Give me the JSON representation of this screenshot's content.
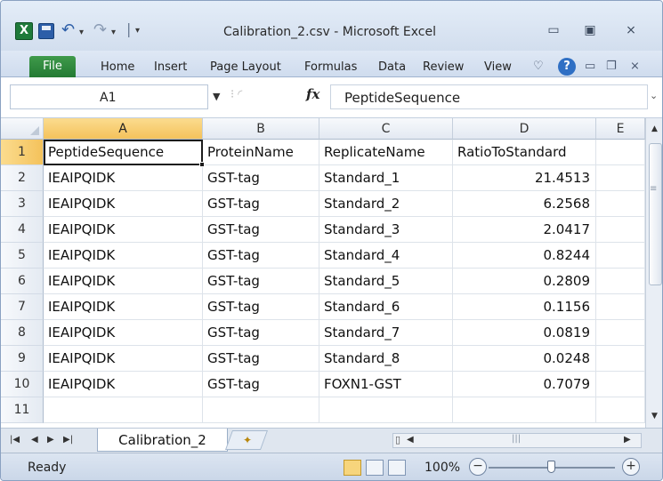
{
  "window": {
    "title": "Calibration_2.csv - Microsoft Excel",
    "controls": {
      "minimize": "▭",
      "restore": "▣",
      "close": "⨯"
    }
  },
  "quick_access": {
    "icons": [
      "excel-icon",
      "save-icon",
      "undo-icon",
      "redo-icon",
      "customize-icon"
    ],
    "separator": "|"
  },
  "ribbon": {
    "file_label": "File",
    "tabs": [
      "Home",
      "Insert",
      "Page Layout",
      "Formulas",
      "Data",
      "Review",
      "View"
    ],
    "help": "?"
  },
  "formula_bar": {
    "name_box": "A1",
    "fx_label": "fx",
    "content": "PeptideSequence"
  },
  "grid": {
    "columns": [
      "A",
      "B",
      "C",
      "D",
      "E"
    ],
    "row_numbers": [
      "1",
      "2",
      "3",
      "4",
      "5",
      "6",
      "7",
      "8",
      "9",
      "10",
      "11"
    ],
    "rows": [
      [
        "PeptideSequence",
        "ProteinName",
        "ReplicateName",
        "RatioToStandard"
      ],
      [
        "IEAIPQIDK",
        "GST-tag",
        "Standard_1",
        "21.4513"
      ],
      [
        "IEAIPQIDK",
        "GST-tag",
        "Standard_2",
        "6.2568"
      ],
      [
        "IEAIPQIDK",
        "GST-tag",
        "Standard_3",
        "2.0417"
      ],
      [
        "IEAIPQIDK",
        "GST-tag",
        "Standard_4",
        "0.8244"
      ],
      [
        "IEAIPQIDK",
        "GST-tag",
        "Standard_5",
        "0.2809"
      ],
      [
        "IEAIPQIDK",
        "GST-tag",
        "Standard_6",
        "0.1156"
      ],
      [
        "IEAIPQIDK",
        "GST-tag",
        "Standard_7",
        "0.0819"
      ],
      [
        "IEAIPQIDK",
        "GST-tag",
        "Standard_8",
        "0.0248"
      ],
      [
        "IEAIPQIDK",
        "GST-tag",
        "FOXN1-GST",
        "0.7079"
      ]
    ],
    "active_cell": "A1"
  },
  "sheets": {
    "tabs": [
      "Calibration_2"
    ]
  },
  "status": {
    "text": "Ready",
    "zoom": "100%",
    "zoom_level": 1.0
  },
  "colors": {
    "file_tab": "#2a8a3e",
    "selected_header": "#f4c25b",
    "help": "#2f6fc4"
  }
}
